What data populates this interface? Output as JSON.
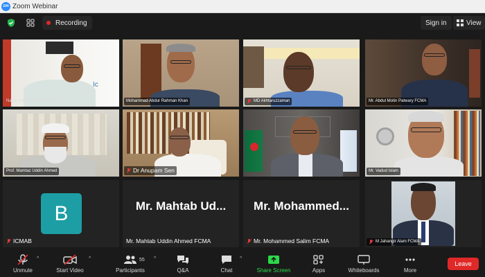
{
  "window": {
    "title": "Zoom Webinar",
    "logo": "zm"
  },
  "topbar": {
    "recording_label": "Recording",
    "signin_label": "Sign in",
    "view_label": "View"
  },
  "participants": [
    {
      "name": "Nazia Ahmed ACS FCMA",
      "muted": false
    },
    {
      "name": "Mohammad Abdur Rahman Khan",
      "muted": false
    },
    {
      "name": "MD Akhtaruzzaman",
      "muted": true
    },
    {
      "name": "Mr. Abdul Motin Patwary FCMA",
      "muted": false
    },
    {
      "name": "Prof. Mamtaz Uddin Ahmed",
      "muted": false
    },
    {
      "name": "Dr Anupam Sen",
      "muted": true
    },
    {
      "name": "",
      "muted": false
    },
    {
      "name": "Mr. Vadud Islam",
      "muted": false
    },
    {
      "name": "ICMAB",
      "muted": true,
      "avatar_letter": "B"
    },
    {
      "name": "Mr. Mahtab Uddin Ahmed FCMA",
      "muted": false,
      "display_name": "Mr. Mahtab Ud..."
    },
    {
      "name": "Mr. Mohammed Salim FCMA",
      "muted": true,
      "display_name": "Mr. Mohammed..."
    },
    {
      "name": "M Jahangir Alam FCMA",
      "muted": true
    }
  ],
  "toolbar": {
    "unmute": "Unmute",
    "start_video": "Start Video",
    "participants": "Participants",
    "participants_count": "55",
    "qa": "Q&A",
    "chat": "Chat",
    "share_screen": "Share Screen",
    "apps": "Apps",
    "whiteboards": "Whiteboards",
    "more": "More",
    "leave": "Leave"
  },
  "colors": {
    "accent_green": "#2bd94a",
    "leave_red": "#e02828",
    "avatar_teal": "#1d9ea5",
    "zoom_blue": "#2d8cff"
  }
}
